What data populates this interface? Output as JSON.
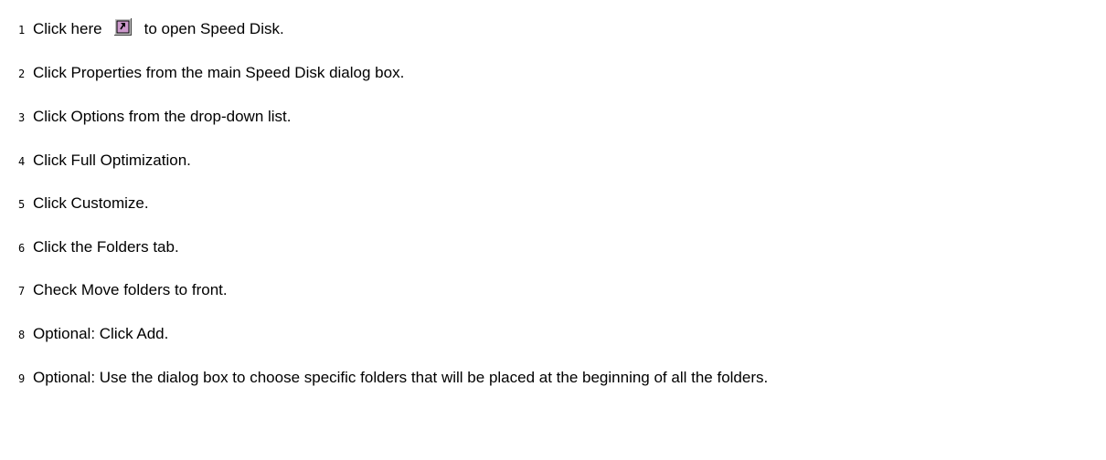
{
  "steps": [
    {
      "num": "1",
      "before": "Click here",
      "after": "to open Speed Disk.",
      "icon": "speed-disk-launch-icon"
    },
    {
      "num": "2",
      "text": "Click Properties from the main Speed Disk dialog box."
    },
    {
      "num": "3",
      "text": "Click Options from the drop-down list."
    },
    {
      "num": "4",
      "text": "Click Full Optimization."
    },
    {
      "num": "5",
      "text": "Click Customize."
    },
    {
      "num": "6",
      "text": "Click the Folders tab."
    },
    {
      "num": "7",
      "text": "Check Move folders to front."
    },
    {
      "num": "8",
      "text": "Optional: Click Add."
    },
    {
      "num": "9",
      "text": "Optional: Use the dialog box to choose specific folders that will be placed at the beginning of all the folders."
    }
  ]
}
